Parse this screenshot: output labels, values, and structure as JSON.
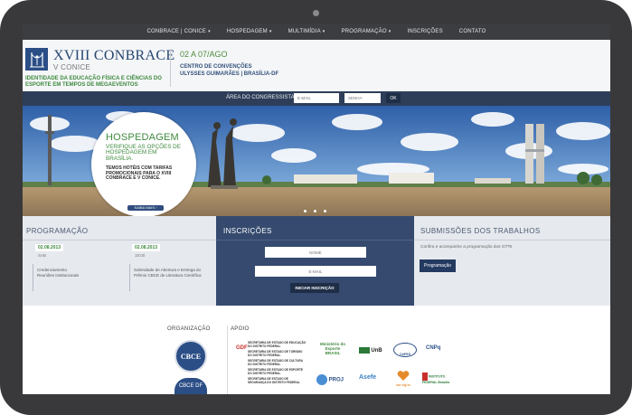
{
  "nav": {
    "items": [
      {
        "label": "CONBRACE | CONICE",
        "dropdown": true
      },
      {
        "label": "HOSPEDAGEM",
        "dropdown": true
      },
      {
        "label": "MULTIMÍDIA",
        "dropdown": true
      },
      {
        "label": "PROGRAMAÇÃO",
        "dropdown": true
      },
      {
        "label": "INSCRIÇÕES",
        "dropdown": false
      },
      {
        "label": "CONTATO",
        "dropdown": false
      }
    ]
  },
  "header": {
    "title": "XVIII CONBRACE",
    "subtitle": "V CONICE",
    "tagline": "IDENTIDADE DA EDUCAÇÃO FÍSICA E CIÊNCIAS DO ESPORTE EM TEMPOS DE MEGAEVENTOS",
    "dates": "02 A 07/AGO",
    "venue_line1": "CENTRO DE CONVENÇÕES",
    "venue_line2": "ULYSSES GUIMARÃES | BRASÍLIA-DF",
    "social": [
      "t",
      "◎",
      "f"
    ]
  },
  "login": {
    "label": "ÁREA DO CONGRESSISTA:",
    "email_placeholder": "E-MAIL",
    "password_placeholder": "SENHA",
    "ok_label": "OK"
  },
  "hero": {
    "title": "HOSPEDAGEM",
    "text": "VERIFIQUE AS OPÇÕES DE HOSPEDAGEM EM BRASÍLIA.",
    "subtext": "TEMOS HOTÉIS COM TARIFAS PROMOCIONAIS PARA O XVIII CONBRACE E V CONICE.",
    "more_label": "SAIBA MAIS ›"
  },
  "programacao": {
    "title": "PROGRAMAÇÃO",
    "events": [
      {
        "date": "02.08.2013",
        "time": "SAB",
        "text": "Credenciamento\nReuniões Institucionais"
      },
      {
        "date": "02.08.2013",
        "time": "18:00",
        "text": "Solenidade de Abertura e Entrega do Prêmio CBCE de Literatura Científica"
      }
    ]
  },
  "inscricoes": {
    "title": "INSCRIÇÕES",
    "name_placeholder": "NOME",
    "email_placeholder": "E-MAIL",
    "button_label": "INICIAR INSCRIÇÃO"
  },
  "submissoes": {
    "title": "SUBMISSÕES DOS TRABALHOS",
    "text": "Confira e acompanhe a programação dos GTTs",
    "button_label": "Programação"
  },
  "sponsors": {
    "org_title": "ORGANIZAÇÃO",
    "apoio_title": "APOIO",
    "seal_label": "CBCE",
    "seal2_label": "CBCE DF",
    "logos": [
      "Ministério do Esporte BRASIL",
      "UnB",
      "CAPES",
      "CNPq",
      "PROJ",
      "Asefe",
      "ser·vig·iv"
    ],
    "gdf_lines": [
      "SECRETARIA DE ESTADO DE EDUCAÇÃO DO DISTRITO FEDERAL",
      "SECRETARIA DE ESTADO DE TURISMO DO DISTRITO FEDERAL",
      "SECRETARIA DE ESTADO DE CULTURA DO DISTRITO FEDERAL",
      "SECRETARIA DE ESTADO DE ESPORTE DO DISTRITO FEDERAL",
      "SECRETARIA DE ESTADO DE SEGURANÇA DO DISTRITO FEDERAL"
    ],
    "gdf_label": "GDF",
    "if_label": "INSTITUTO FEDERAL Brasília"
  },
  "colors": {
    "frame": "#39393b",
    "nav_bg": "#3b3d40",
    "brand_blue": "#2b4e86",
    "brand_green": "#3f8a3f",
    "inscricoes_bg": "#354a6e"
  }
}
